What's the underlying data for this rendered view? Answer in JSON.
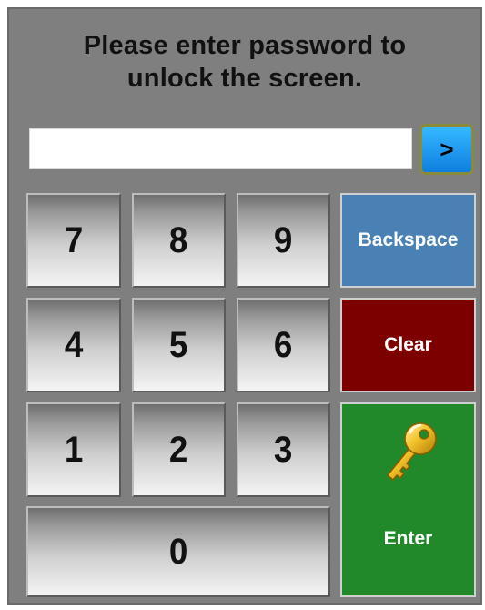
{
  "prompt": {
    "line1": "Please enter password to",
    "line2": "unlock the screen."
  },
  "password_field": {
    "value": "",
    "placeholder": ""
  },
  "go_button": {
    "label": ">"
  },
  "keypad": {
    "keys": [
      "7",
      "8",
      "9",
      "4",
      "5",
      "6",
      "1",
      "2",
      "3",
      "0"
    ]
  },
  "actions": {
    "backspace_label": "Backspace",
    "clear_label": "Clear",
    "enter_label": "Enter",
    "enter_icon": "key-icon"
  },
  "colors": {
    "panel": "#7f7f7f",
    "backspace": "#4a81b5",
    "clear": "#7d0000",
    "enter": "#22892a",
    "go_button": "#1e9af0"
  }
}
